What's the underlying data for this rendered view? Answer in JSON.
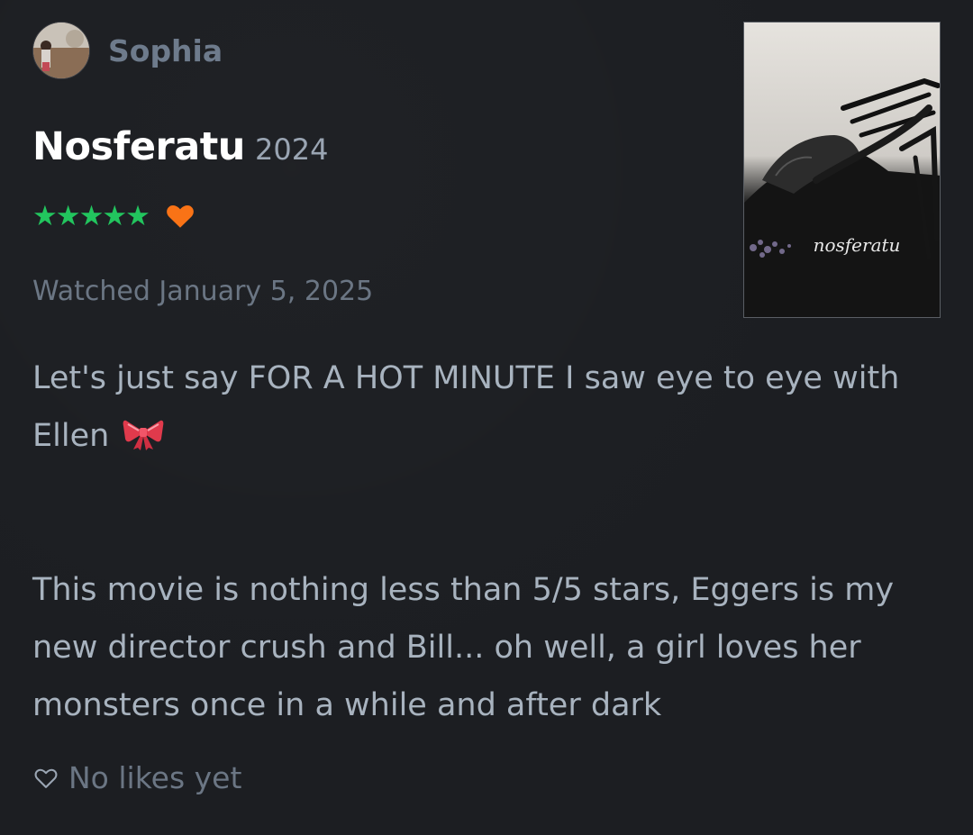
{
  "user": {
    "name": "Sophia"
  },
  "film": {
    "title": "Nosferatu",
    "year": "2024",
    "rating_stars": 5,
    "stars_text": "★★★★★",
    "liked": true,
    "poster_logo_text": "nosferatu"
  },
  "watched": {
    "text": "Watched January 5, 2025"
  },
  "review": {
    "paragraph1": "Let's just say FOR A HOT MINUTE I saw eye to eye with Ellen",
    "paragraph1_emoji": "bow-icon",
    "paragraph2": "This movie is nothing less than 5/5 stars, Eggers is my new director crush and Bill... oh well, a girl loves her monsters once in a while and after dark"
  },
  "likes": {
    "text": "No likes yet"
  },
  "colors": {
    "background": "#1c1e22",
    "star_green": "#22c55e",
    "heart_orange": "#f97316",
    "username": "#6e7b8c",
    "body_text": "#a8b3bf",
    "muted_text": "#6b7684"
  }
}
